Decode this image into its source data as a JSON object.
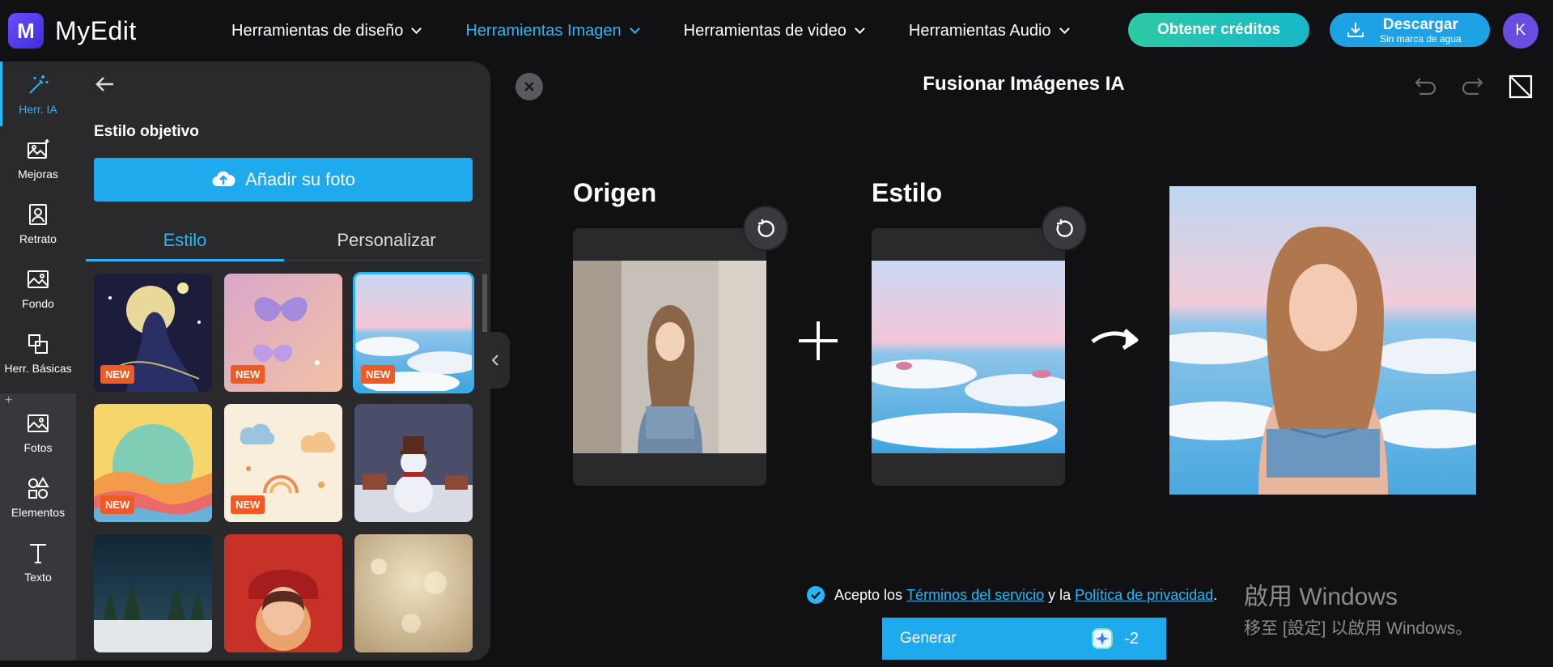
{
  "app": {
    "logo_letter": "M",
    "name": "MyEdit"
  },
  "nav": [
    {
      "label": "Herramientas de diseño",
      "active": false
    },
    {
      "label": "Herramientas Imagen",
      "active": true
    },
    {
      "label": "Herramientas de video",
      "active": false
    },
    {
      "label": "Herramientas Audio",
      "active": false
    }
  ],
  "header": {
    "credits_label": "Obtener créditos",
    "download_label": "Descargar",
    "download_sub": "Sin marca de agua",
    "avatar_initial": "K"
  },
  "rail": [
    {
      "label": "Herr. IA",
      "icon": "magic-wand-icon",
      "active": true
    },
    {
      "label": "Mejoras",
      "icon": "image-sparkle-icon"
    },
    {
      "label": "Retrato",
      "icon": "portrait-icon"
    },
    {
      "label": "Fondo",
      "icon": "background-icon"
    },
    {
      "label": "Herr. Básicas",
      "icon": "crop-icon"
    },
    {
      "label": "Fotos",
      "icon": "photo-icon"
    },
    {
      "label": "Elementos",
      "icon": "shapes-icon"
    },
    {
      "label": "Texto",
      "icon": "text-icon"
    }
  ],
  "rail_plus": "+",
  "panel": {
    "title": "Estilo objetivo",
    "add_photo_label": "Añadir su foto",
    "tabs": [
      {
        "label": "Estilo",
        "active": true
      },
      {
        "label": "Personalizar",
        "active": false
      }
    ],
    "new_badge": "NEW",
    "styles": [
      {
        "name": "night-goddess",
        "new": true
      },
      {
        "name": "pink-butterflies",
        "new": true
      },
      {
        "name": "snowy-sea",
        "new": true,
        "selected": true
      },
      {
        "name": "rainbow-landscape",
        "new": true
      },
      {
        "name": "clouds-pattern",
        "new": true
      },
      {
        "name": "snowman-village",
        "new": false
      },
      {
        "name": "winter-forest",
        "new": false
      },
      {
        "name": "red-hood-girl",
        "new": false
      },
      {
        "name": "golden-bokeh",
        "new": false
      }
    ]
  },
  "main": {
    "title": "Fusionar Imágenes IA",
    "source_label": "Origen",
    "style_label": "Estilo",
    "terms_prefix": "Acepto los",
    "terms_link": "Términos del servicio",
    "terms_mid": "y la",
    "privacy_link": "Política de privacidad",
    "terms_suffix": ".",
    "generate_label": "Generar",
    "generate_cost": "-2"
  },
  "watermark": {
    "line1": "啟用 Windows",
    "line2": "移至 [設定] 以啟用 Windows。"
  },
  "colors": {
    "accent": "#29b6f6",
    "button": "#1eaaec",
    "new_badge": "#f25a24",
    "credits_start": "#2ec9a6"
  }
}
